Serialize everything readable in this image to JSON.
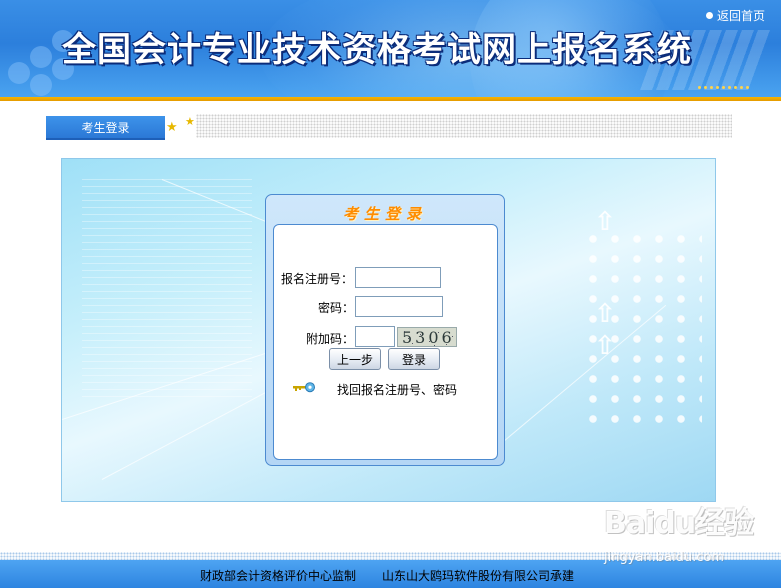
{
  "header": {
    "site_title": "全国会计专业技术资格考试网上报名系统",
    "back_link_label": "返回首页"
  },
  "tabs": [
    {
      "label": "考生登录",
      "active": true
    }
  ],
  "login_box": {
    "title": "考生登录",
    "fields": {
      "registration_number": {
        "label": "报名注册号：",
        "value": ""
      },
      "password": {
        "label": "密码：",
        "value": ""
      },
      "captcha": {
        "label": "附加码：",
        "value": "",
        "captcha_text": "5306"
      }
    },
    "buttons": {
      "back": "上一步",
      "login": "登录"
    },
    "recover_link": "找回报名注册号、密码"
  },
  "footer": {
    "supervisor": "财政部会计资格评价中心监制",
    "undertaker": "山东山大鸥玛软件股份有限公司承建"
  },
  "watermark": {
    "brand": "Baidu经验",
    "url": "jingyan.baidu.com"
  },
  "colors": {
    "header_blue": "#2c7fdc",
    "gold_accent": "#f6b400",
    "title_orange": "#ff8c00",
    "tab_blue": "#2b78d6"
  },
  "icons": [
    "bullet-icon",
    "star-icon",
    "key-icon",
    "up-arrow-icon"
  ]
}
